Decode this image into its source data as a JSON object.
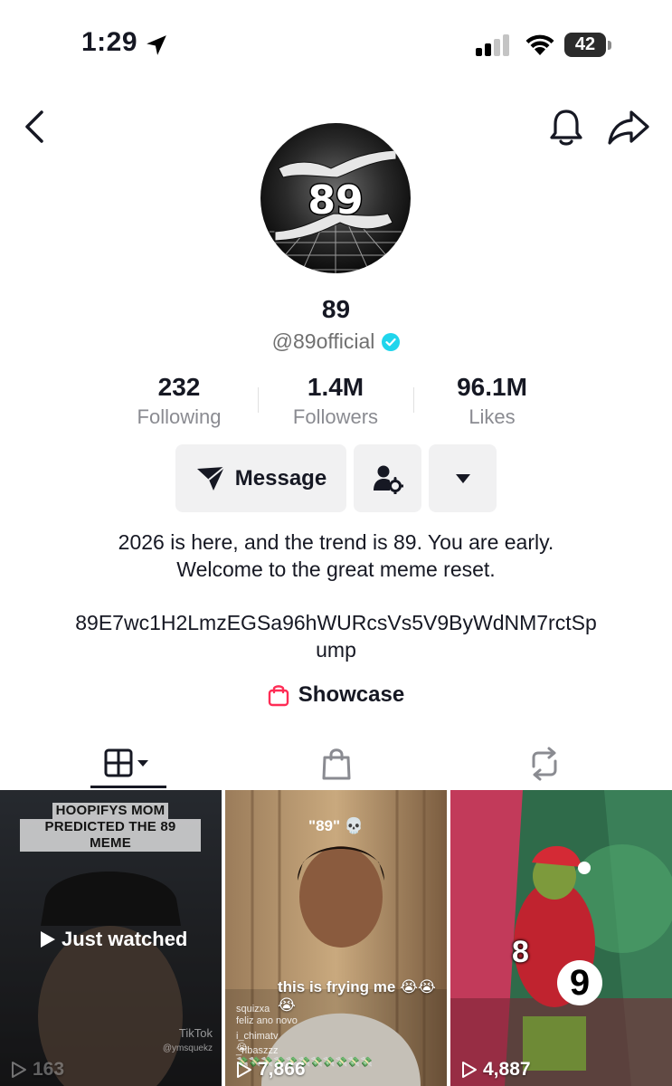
{
  "status_bar": {
    "time": "1:29",
    "battery": "42",
    "battery_level": 0.42
  },
  "nav": {
    "back_icon": "chevron-left-icon",
    "bell_icon": "bell-icon",
    "share_icon": "share-icon"
  },
  "profile": {
    "avatar_text": "89",
    "display_name": "89",
    "handle": "@89official",
    "verified": true,
    "verified_color": "#20d5ec"
  },
  "stats": {
    "following": {
      "value": "232",
      "label": "Following"
    },
    "followers": {
      "value": "1.4M",
      "label": "Followers"
    },
    "likes": {
      "value": "96.1M",
      "label": "Likes"
    }
  },
  "actions": {
    "message_label": "Message",
    "message_icon": "send-icon",
    "follow_settings_icon": "user-gear-icon",
    "dropdown_icon": "caret-down-icon"
  },
  "bio": {
    "line1": "2026 is here, and the trend is 89. You are early.",
    "line2": "Welcome to the great meme reset.",
    "contract_line1": "89E7wc1H2LmzEGSa96hWURcsVs5V9ByWdNM7rctSp",
    "contract_line2": "ump"
  },
  "showcase": {
    "label": "Showcase",
    "icon": "shopping-bag-icon",
    "icon_color": "#fe2c55"
  },
  "tabs": [
    {
      "name": "videos",
      "icon": "grid-icon",
      "active": true
    },
    {
      "name": "shop",
      "icon": "shopping-bag-icon",
      "active": false
    },
    {
      "name": "reposts",
      "icon": "repost-icon",
      "active": false
    }
  ],
  "videos": [
    {
      "caption_line1": "HOOPIFYS MOM",
      "caption_line2": "PREDICTED THE 89 MEME",
      "overlay": "Just watched",
      "watermark": "TikTok",
      "watermark_user": "@ymsquekz",
      "plays": "163"
    },
    {
      "title": "\"89\" 💀",
      "overlay": "this is frying me 😭😭😭",
      "chat": [
        {
          "user": "squizxa",
          "text": "feliz ano novo"
        },
        {
          "user": "i_chimatv",
          "text": "😭"
        },
        {
          "user": "_ribaszzz",
          "text": "💸💸💸💸💸💸💸💸💸💸💸"
        }
      ],
      "plays": "7,866"
    },
    {
      "overlay_8": "8",
      "overlay_9": "9",
      "plays": "4,887"
    }
  ]
}
